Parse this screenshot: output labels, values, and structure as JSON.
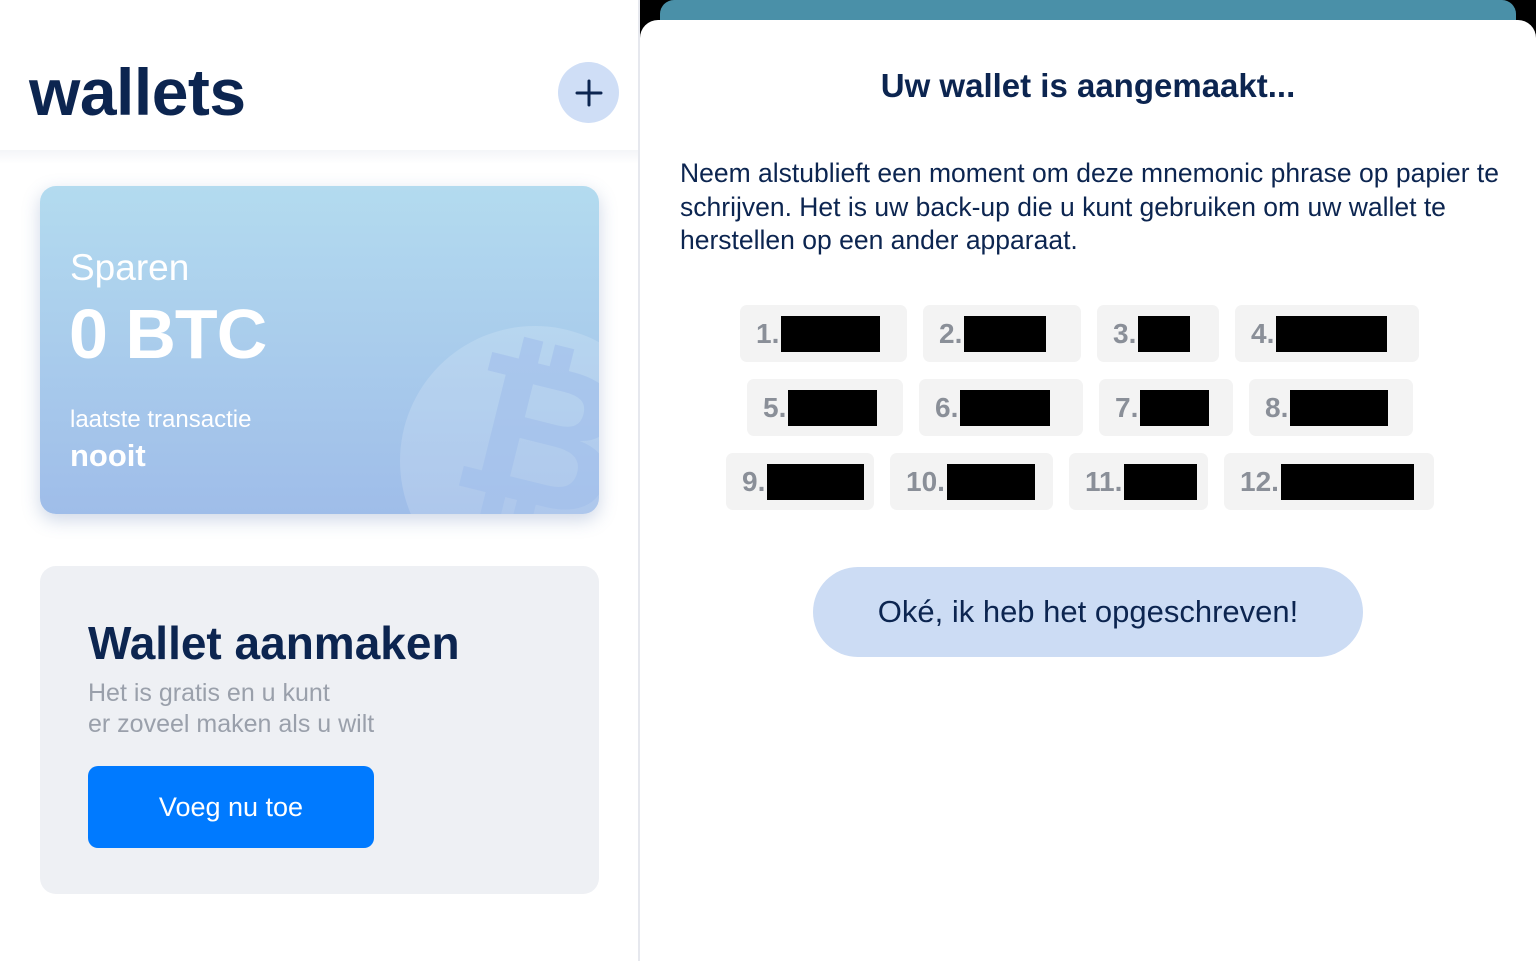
{
  "left": {
    "title": "wallets",
    "add_button_icon": "plus-icon",
    "wallet_card": {
      "name": "Sparen",
      "balance": "0 BTC",
      "last_tx_label": "laatste transactie",
      "last_tx_value": "nooit",
      "background_icon": "bitcoin-icon"
    },
    "create_card": {
      "title": "Wallet aanmaken",
      "description_line1": "Het is gratis en u kunt",
      "description_line2": "er zoveel maken als u wilt",
      "button_label": "Voeg nu toe"
    }
  },
  "modal": {
    "title": "Uw wallet is aangemaakt...",
    "description": "Neem alstublieft een moment om deze mnemonic phrase op papier te schrijven. Het is uw back-up die u kunt gebruiken om uw wallet te herstellen op een ander apparaat.",
    "words": [
      {
        "num": "1."
      },
      {
        "num": "2."
      },
      {
        "num": "3."
      },
      {
        "num": "4."
      },
      {
        "num": "5."
      },
      {
        "num": "6."
      },
      {
        "num": "7."
      },
      {
        "num": "8."
      },
      {
        "num": "9."
      },
      {
        "num": "10."
      },
      {
        "num": "11."
      },
      {
        "num": "12."
      }
    ],
    "confirm_button_label": "Oké, ik heb het opgeschreven!"
  },
  "colors": {
    "primary_text": "#0c2550",
    "accent_blue": "#007aff",
    "card_gradient_top": "#b3dbef",
    "card_gradient_bottom": "#9fbde9",
    "confirm_button_bg": "#ccdcf4",
    "add_button_bg": "#cfdef6"
  }
}
